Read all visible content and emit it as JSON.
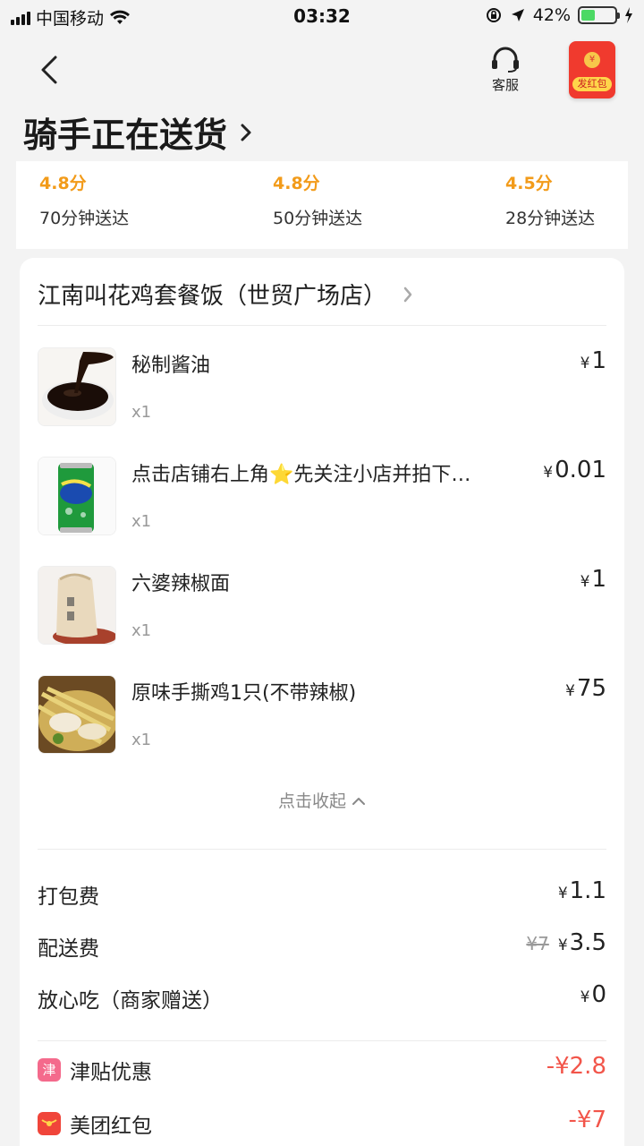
{
  "status_bar": {
    "carrier": "中国移动",
    "time": "03:32",
    "battery": "42%",
    "battery_level": 0.42
  },
  "header": {
    "service_label": "客服",
    "redpack_label": "发红包",
    "status_title": "骑手正在送货"
  },
  "ratings": [
    {
      "score": "4.8分",
      "time": "70分钟送达"
    },
    {
      "score": "4.8分",
      "time": "50分钟送达"
    },
    {
      "score": "4.5分",
      "time": "28分钟送达"
    }
  ],
  "order": {
    "shop_name": "江南叫花鸡套餐饭（世贸广场店）",
    "items": [
      {
        "name": "秘制酱油",
        "qty": "x1",
        "currency": "¥",
        "price": "1",
        "thumb": "soy-sauce-image"
      },
      {
        "name": "点击店铺右上角⭐先关注小店并拍下…",
        "qty": "x1",
        "currency": "¥",
        "price": "0.01",
        "thumb": "soda-can-image"
      },
      {
        "name": "六婆辣椒面",
        "qty": "x1",
        "currency": "¥",
        "price": "1",
        "thumb": "chili-powder-image"
      },
      {
        "name": "原味手撕鸡1只(不带辣椒)",
        "qty": "x1",
        "currency": "¥",
        "price": "75",
        "thumb": "shredded-chicken-image"
      }
    ],
    "collapse_label": "点击收起",
    "fees": {
      "packing": {
        "label": "打包费",
        "currency": "¥",
        "value": "1.1"
      },
      "delivery": {
        "label": "配送费",
        "old": "¥7",
        "currency": "¥",
        "value": "3.5"
      },
      "safe_eat": {
        "label": "放心吃（商家赠送）",
        "currency": "¥",
        "value": "0"
      },
      "subsidy": {
        "icon_text": "津",
        "label": "津贴优惠",
        "value": "-¥2.8"
      },
      "redpacket": {
        "label": "美团红包",
        "value": "-¥7"
      }
    }
  },
  "colors": {
    "accent_orange": "#f29b1a",
    "discount_red": "#f2554a",
    "subsidy_pink": "#f46a8c",
    "redpack_red": "#f03a2e"
  }
}
